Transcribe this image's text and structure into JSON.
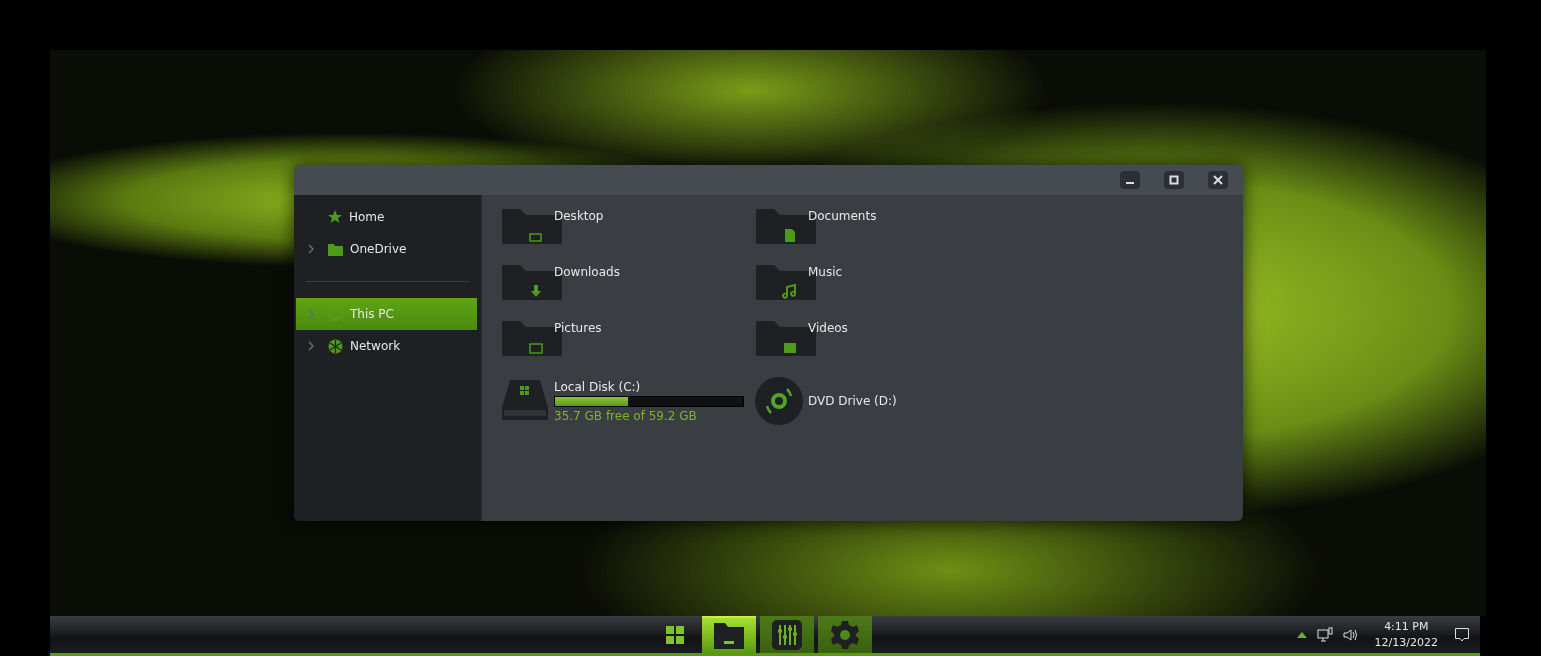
{
  "sidebar": {
    "items": [
      {
        "label": "Home",
        "kind": "home",
        "expandable": false,
        "selected": false
      },
      {
        "label": "OneDrive",
        "kind": "cloud",
        "expandable": true,
        "selected": false
      },
      {
        "label": "This PC",
        "kind": "pc",
        "expandable": true,
        "selected": true
      },
      {
        "label": "Network",
        "kind": "network",
        "expandable": true,
        "selected": false
      }
    ]
  },
  "folders": [
    {
      "name": "Desktop",
      "kind": "desktop"
    },
    {
      "name": "Documents",
      "kind": "documents"
    },
    {
      "name": "Downloads",
      "kind": "downloads"
    },
    {
      "name": "Music",
      "kind": "music"
    },
    {
      "name": "Pictures",
      "kind": "pictures"
    },
    {
      "name": "Videos",
      "kind": "videos"
    }
  ],
  "drives": [
    {
      "name": "Local Disk (C:)",
      "kind": "disk",
      "level": 0.39,
      "free": "35.7 GB free of 59.2 GB"
    },
    {
      "name": "DVD Drive (D:)",
      "kind": "dvd"
    }
  ],
  "taskbar": {
    "apps": [
      {
        "kind": "start",
        "selected": false
      },
      {
        "kind": "explorer",
        "selected": true
      },
      {
        "kind": "mixer",
        "selected": false
      },
      {
        "kind": "settings",
        "selected": false
      }
    ],
    "time": "4:11 PM",
    "date": "12/13/2022"
  }
}
